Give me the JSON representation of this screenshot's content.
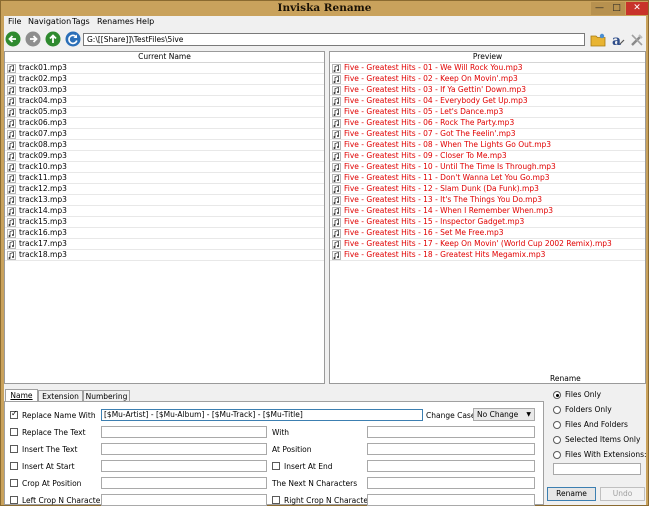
{
  "window": {
    "title": "Inviska Rename"
  },
  "menu": [
    "File",
    "Navigation",
    "Tags",
    "Renames",
    "Help"
  ],
  "toolbar": {
    "path": "G:\\[[Share]]\\TestFiles\\5ive"
  },
  "current": {
    "header": "Current Name",
    "files": [
      "track01.mp3",
      "track02.mp3",
      "track03.mp3",
      "track04.mp3",
      "track05.mp3",
      "track06.mp3",
      "track07.mp3",
      "track08.mp3",
      "track09.mp3",
      "track10.mp3",
      "track11.mp3",
      "track12.mp3",
      "track13.mp3",
      "track14.mp3",
      "track15.mp3",
      "track16.mp3",
      "track17.mp3",
      "track18.mp3"
    ]
  },
  "preview": {
    "header": "Preview",
    "files": [
      "Five - Greatest Hits - 01 - We Will Rock You.mp3",
      "Five - Greatest Hits - 02 - Keep On Movin'.mp3",
      "Five - Greatest Hits - 03 - If Ya Gettin' Down.mp3",
      "Five - Greatest Hits - 04 - Everybody Get Up.mp3",
      "Five - Greatest Hits - 05 - Let's Dance.mp3",
      "Five - Greatest Hits - 06 - Rock The Party.mp3",
      "Five - Greatest Hits - 07 - Got The Feelin'.mp3",
      "Five - Greatest Hits - 08 - When The Lights Go Out.mp3",
      "Five - Greatest Hits - 09 - Closer To Me.mp3",
      "Five - Greatest Hits - 10 - Until The Time Is Through.mp3",
      "Five - Greatest Hits - 11 - Don't Wanna Let You Go.mp3",
      "Five - Greatest Hits - 12 - Slam Dunk (Da Funk).mp3",
      "Five - Greatest Hits - 13 - It's The Things You Do.mp3",
      "Five - Greatest Hits - 14 - When I Remember When.mp3",
      "Five - Greatest Hits - 15 - Inspector Gadget.mp3",
      "Five - Greatest Hits - 16 - Set Me Free.mp3",
      "Five - Greatest Hits - 17 - Keep On Movin' (World Cup 2002 Remix).mp3",
      "Five - Greatest Hits - 18 - Greatest Hits Megamix.mp3"
    ]
  },
  "tabs": [
    "Name",
    "Extension",
    "Numbering"
  ],
  "name_tab": {
    "replace_name_with": {
      "label": "Replace Name With",
      "checked": true,
      "value": "[$Mu-Artist] - [$Mu-Album] - [$Mu-Track] - [$Mu-Title]"
    },
    "change_case": {
      "label": "Change Case",
      "value": "No Change"
    },
    "replace_the_text": {
      "label": "Replace The Text"
    },
    "with": {
      "label": "With"
    },
    "insert_the_text": {
      "label": "Insert The Text"
    },
    "at_position": {
      "label": "At Position"
    },
    "insert_at_start": {
      "label": "Insert At Start"
    },
    "insert_at_end": {
      "label": "Insert At End"
    },
    "crop_at_position": {
      "label": "Crop At Position"
    },
    "next_n_chars": {
      "label": "The Next N Characters"
    },
    "left_crop": {
      "label": "Left Crop N Characters"
    },
    "right_crop": {
      "label": "Right Crop N Characters"
    }
  },
  "rename_group": {
    "title": "Rename",
    "options": [
      "Files Only",
      "Folders Only",
      "Files And Folders",
      "Selected Items Only",
      "Files With Extensions:"
    ],
    "selected": "Files Only",
    "rename_button": "Rename",
    "undo_button": "Undo"
  },
  "colors": {
    "title_bar": "#c9a25c",
    "preview_text": "#e00000"
  }
}
